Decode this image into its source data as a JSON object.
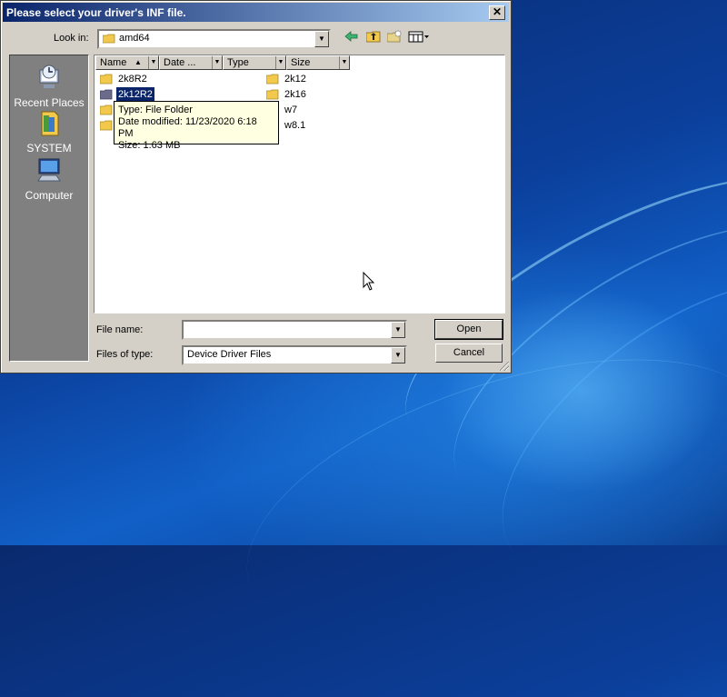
{
  "dialog": {
    "title": "Please select your driver's INF file.",
    "close_glyph": "✕"
  },
  "lookin": {
    "label": "Look in:",
    "value": "amd64"
  },
  "toolbar": {
    "back_icon": "back-arrow-icon",
    "up_icon": "up-folder-icon",
    "new_folder_icon": "new-folder-icon",
    "views_icon": "views-menu-icon"
  },
  "places": [
    {
      "label": "Recent Places",
      "icon": "recent-places-icon"
    },
    {
      "label": "SYSTEM",
      "icon": "user-folder-icon"
    },
    {
      "label": "Computer",
      "icon": "computer-icon"
    }
  ],
  "columns": [
    "Name",
    "Date ...",
    "Type",
    "Size"
  ],
  "files": [
    {
      "name": "2k8R2",
      "selected": false
    },
    {
      "name": "2k12R2",
      "selected": true
    },
    {
      "name": "",
      "selected": false
    },
    {
      "name": "",
      "selected": false
    },
    {
      "name": "2k12",
      "selected": false
    },
    {
      "name": "2k16",
      "selected": false
    },
    {
      "name": "w7",
      "selected": false
    },
    {
      "name": "w8.1",
      "selected": false
    }
  ],
  "tooltip": {
    "line1": "Type: File Folder",
    "line2": "Date modified: 11/23/2020 6:18 PM",
    "line3": "Size: 1.63 MB"
  },
  "filename": {
    "label": "File name:",
    "value": ""
  },
  "filetype": {
    "label": "Files of type:",
    "value": "Device Driver Files"
  },
  "buttons": {
    "open": "Open",
    "cancel": "Cancel"
  },
  "colors": {
    "title_start": "#0a246a",
    "title_end": "#a6caf0",
    "dialog_face": "#d4d0c8",
    "selection": "#0a246a",
    "tooltip_bg": "#ffffe1",
    "folder": "#f2c94c"
  }
}
